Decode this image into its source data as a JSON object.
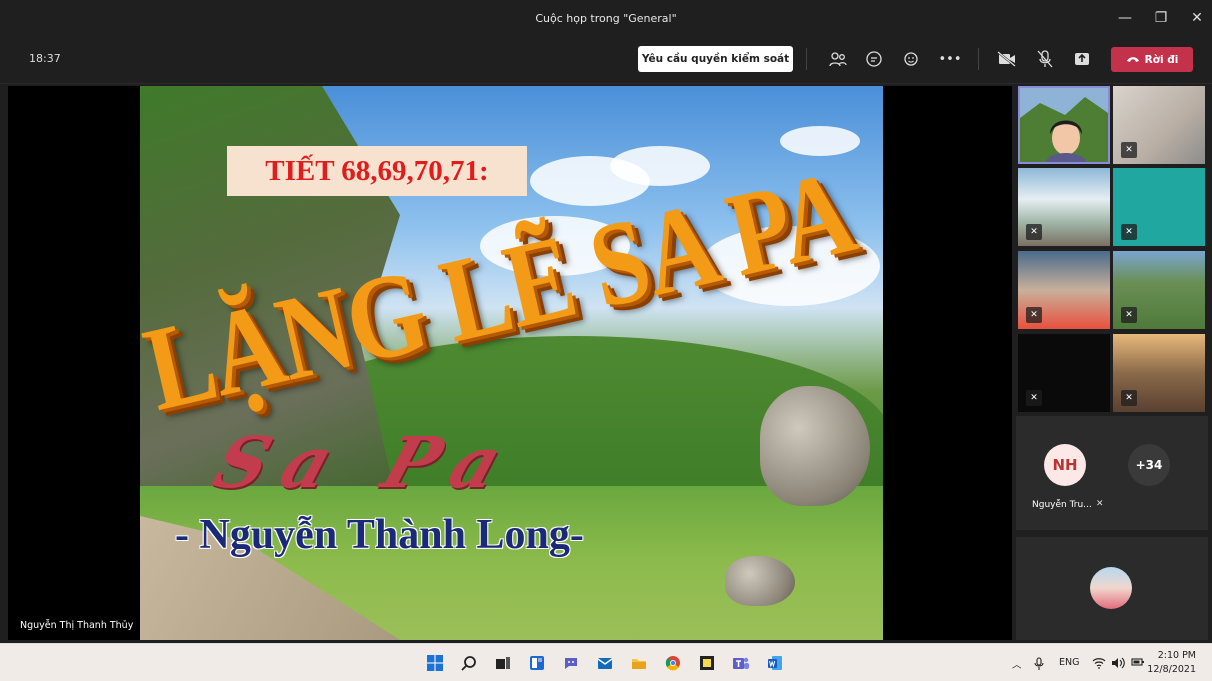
{
  "window": {
    "title": "Cuộc họp trong \"General\"",
    "controls": [
      "minimize-icon",
      "maximize-icon",
      "close-icon"
    ]
  },
  "toolbar": {
    "time": "18:37",
    "request_control": "Yêu cầu quyền kiểm soát",
    "leave": "Rời đi",
    "icons": [
      "participants-icon",
      "chat-icon",
      "reactions-icon",
      "more-icon",
      "camera-off-icon",
      "mic-off-icon",
      "share-icon"
    ],
    "leave_color": "#c4314b"
  },
  "slide": {
    "lesson": "TIẾT 68,69,70,71:",
    "title": "LẶNG LẼ SA PA",
    "flowerbed": "Sa Pa",
    "author": "- Nguyễn Thành Long-"
  },
  "presenter_name": "Nguyễn Thị Thanh Thủy",
  "participants": {
    "initials": "NH",
    "name": "Nguyễn Tru...",
    "overflow": "+34"
  },
  "taskbar": {
    "lang": "ENG",
    "time": "2:10 PM",
    "date": "12/8/2021"
  }
}
